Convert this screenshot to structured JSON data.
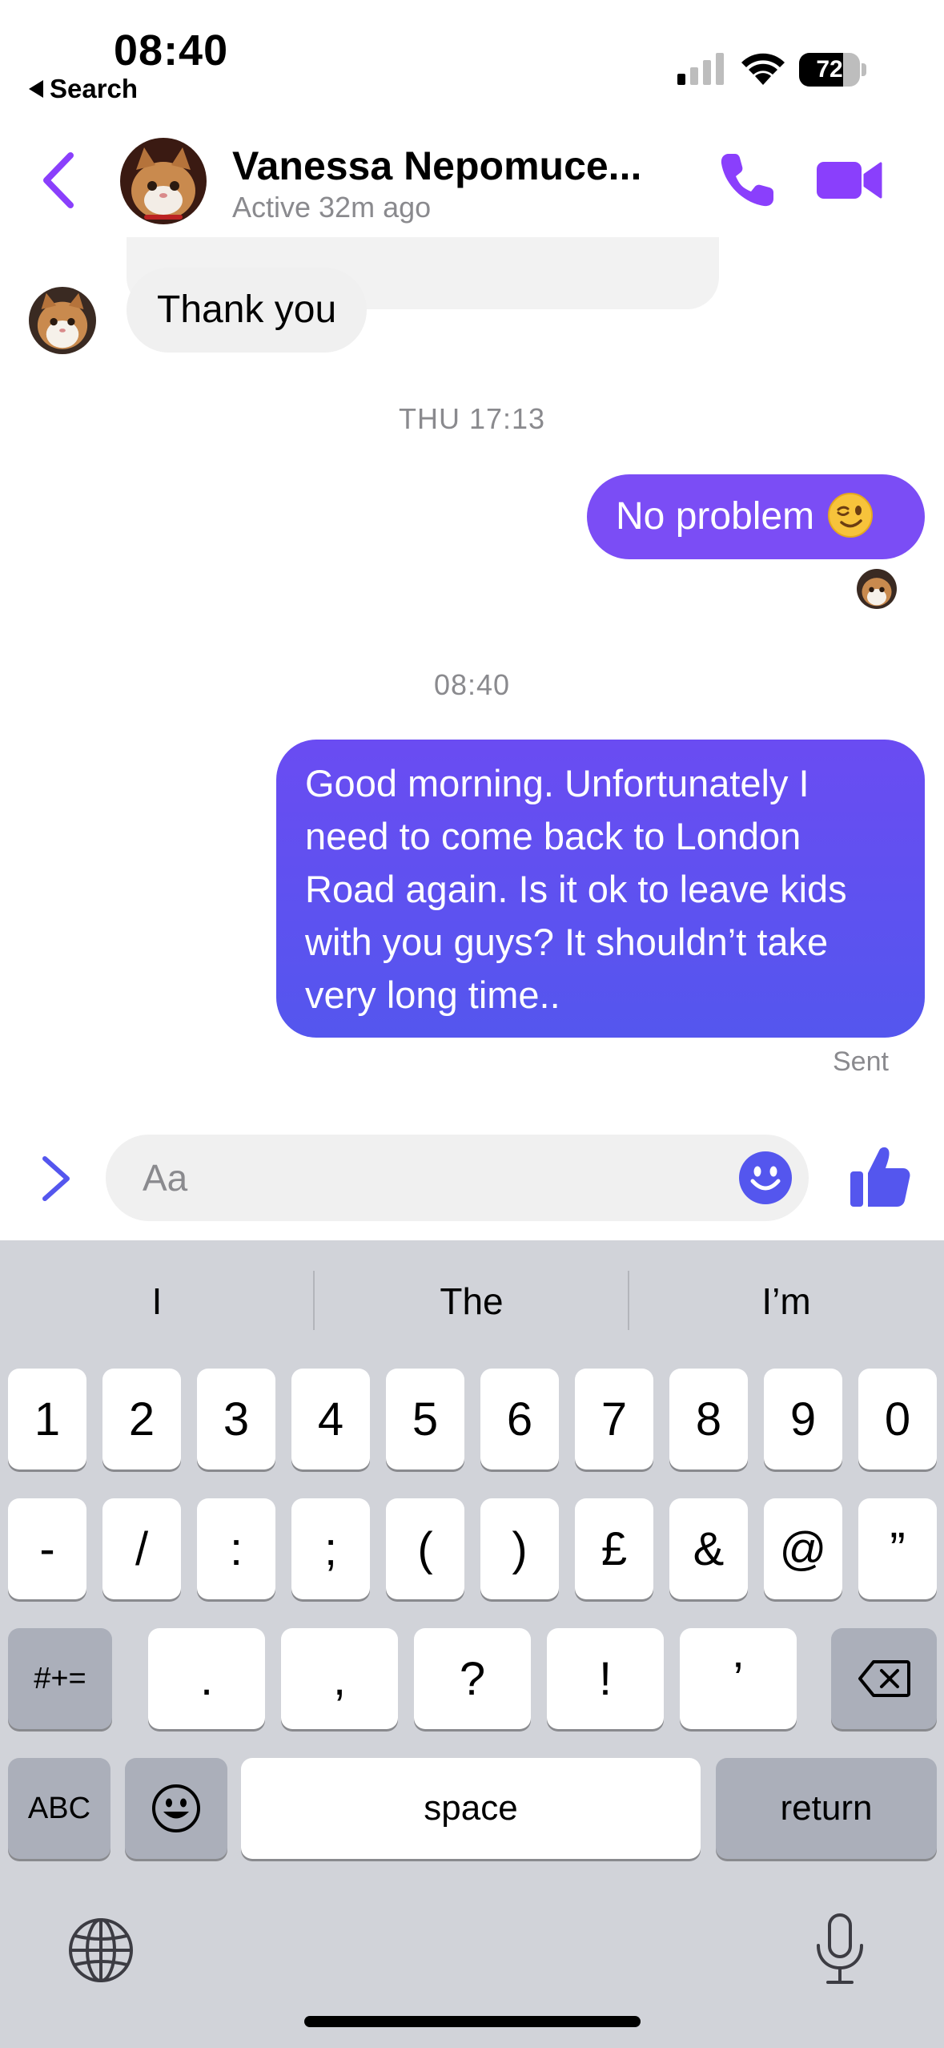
{
  "status_bar": {
    "time": "08:40",
    "back_app_label": "Search",
    "battery_level": "72",
    "battery_fraction": 0.72,
    "icons": [
      "cellular-signal-icon",
      "wifi-icon",
      "battery-icon"
    ]
  },
  "header": {
    "contact_name": "Vanessa Nepomuce...",
    "contact_status": "Active 32m ago",
    "icons": [
      "back-chevron-icon",
      "phone-icon",
      "video-camera-icon"
    ]
  },
  "conversation": {
    "incoming_message": "Thank you",
    "timestamp_1": "THU 17:13",
    "outgoing_message_1": "No problem",
    "outgoing_message_1_emoji": "winking-face",
    "timestamp_2": "08:40",
    "outgoing_message_2": "Good morning. Unfortunately I need to come back to London Road again. Is it ok to leave kids with you guys? It shouldn’t take very long time..",
    "delivery_status": "Sent"
  },
  "composer": {
    "placeholder": "Aa",
    "value": "",
    "icons": [
      "chevron-right-icon",
      "smiley-icon",
      "thumbs-up-icon"
    ]
  },
  "keyboard": {
    "suggestions": [
      "I",
      "The",
      "I’m"
    ],
    "row1": [
      "1",
      "2",
      "3",
      "4",
      "5",
      "6",
      "7",
      "8",
      "9",
      "0"
    ],
    "row2": [
      "-",
      "/",
      ":",
      ";",
      "(",
      ")",
      "£",
      "&",
      "@",
      "”"
    ],
    "row3": {
      "mode_key": "#+=",
      "keys": [
        ".",
        ",",
        "?",
        "!",
        "’"
      ],
      "delete_icon": "backspace-icon"
    },
    "row4": {
      "abc_key": "ABC",
      "emoji_icon": "emoji-keyboard-icon",
      "space_key": "space",
      "return_key": "return"
    },
    "bottom_icons": [
      "globe-icon",
      "microphone-icon"
    ]
  },
  "colors": {
    "accent_purple": "#8a3ffc",
    "outgoing_bubble": "#7b4df5",
    "outgoing_bubble_gradient_end": "#5456ee",
    "incoming_bubble": "#f0f0f0",
    "keyboard_bg": "#d1d3d9"
  }
}
